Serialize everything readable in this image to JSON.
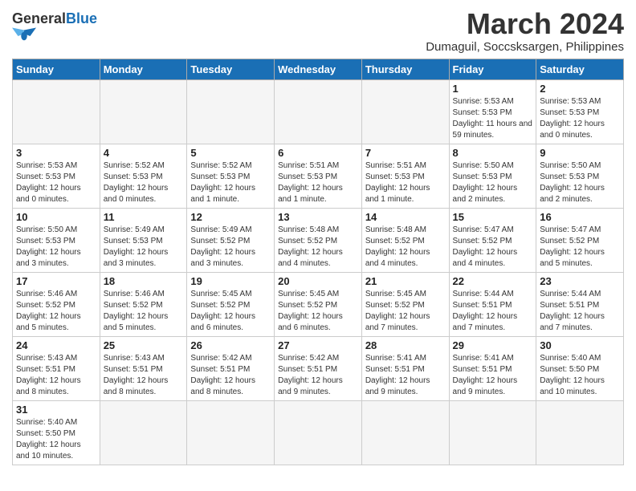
{
  "logo": {
    "general": "General",
    "blue": "Blue"
  },
  "title": {
    "month_year": "March 2024",
    "location": "Dumaguil, Soccsksargen, Philippines"
  },
  "headers": [
    "Sunday",
    "Monday",
    "Tuesday",
    "Wednesday",
    "Thursday",
    "Friday",
    "Saturday"
  ],
  "weeks": [
    [
      {
        "day": "",
        "info": ""
      },
      {
        "day": "",
        "info": ""
      },
      {
        "day": "",
        "info": ""
      },
      {
        "day": "",
        "info": ""
      },
      {
        "day": "",
        "info": ""
      },
      {
        "day": "1",
        "info": "Sunrise: 5:53 AM\nSunset: 5:53 PM\nDaylight: 11 hours and 59 minutes."
      },
      {
        "day": "2",
        "info": "Sunrise: 5:53 AM\nSunset: 5:53 PM\nDaylight: 12 hours and 0 minutes."
      }
    ],
    [
      {
        "day": "3",
        "info": "Sunrise: 5:53 AM\nSunset: 5:53 PM\nDaylight: 12 hours and 0 minutes."
      },
      {
        "day": "4",
        "info": "Sunrise: 5:52 AM\nSunset: 5:53 PM\nDaylight: 12 hours and 0 minutes."
      },
      {
        "day": "5",
        "info": "Sunrise: 5:52 AM\nSunset: 5:53 PM\nDaylight: 12 hours and 1 minute."
      },
      {
        "day": "6",
        "info": "Sunrise: 5:51 AM\nSunset: 5:53 PM\nDaylight: 12 hours and 1 minute."
      },
      {
        "day": "7",
        "info": "Sunrise: 5:51 AM\nSunset: 5:53 PM\nDaylight: 12 hours and 1 minute."
      },
      {
        "day": "8",
        "info": "Sunrise: 5:50 AM\nSunset: 5:53 PM\nDaylight: 12 hours and 2 minutes."
      },
      {
        "day": "9",
        "info": "Sunrise: 5:50 AM\nSunset: 5:53 PM\nDaylight: 12 hours and 2 minutes."
      }
    ],
    [
      {
        "day": "10",
        "info": "Sunrise: 5:50 AM\nSunset: 5:53 PM\nDaylight: 12 hours and 3 minutes."
      },
      {
        "day": "11",
        "info": "Sunrise: 5:49 AM\nSunset: 5:53 PM\nDaylight: 12 hours and 3 minutes."
      },
      {
        "day": "12",
        "info": "Sunrise: 5:49 AM\nSunset: 5:52 PM\nDaylight: 12 hours and 3 minutes."
      },
      {
        "day": "13",
        "info": "Sunrise: 5:48 AM\nSunset: 5:52 PM\nDaylight: 12 hours and 4 minutes."
      },
      {
        "day": "14",
        "info": "Sunrise: 5:48 AM\nSunset: 5:52 PM\nDaylight: 12 hours and 4 minutes."
      },
      {
        "day": "15",
        "info": "Sunrise: 5:47 AM\nSunset: 5:52 PM\nDaylight: 12 hours and 4 minutes."
      },
      {
        "day": "16",
        "info": "Sunrise: 5:47 AM\nSunset: 5:52 PM\nDaylight: 12 hours and 5 minutes."
      }
    ],
    [
      {
        "day": "17",
        "info": "Sunrise: 5:46 AM\nSunset: 5:52 PM\nDaylight: 12 hours and 5 minutes."
      },
      {
        "day": "18",
        "info": "Sunrise: 5:46 AM\nSunset: 5:52 PM\nDaylight: 12 hours and 5 minutes."
      },
      {
        "day": "19",
        "info": "Sunrise: 5:45 AM\nSunset: 5:52 PM\nDaylight: 12 hours and 6 minutes."
      },
      {
        "day": "20",
        "info": "Sunrise: 5:45 AM\nSunset: 5:52 PM\nDaylight: 12 hours and 6 minutes."
      },
      {
        "day": "21",
        "info": "Sunrise: 5:45 AM\nSunset: 5:52 PM\nDaylight: 12 hours and 7 minutes."
      },
      {
        "day": "22",
        "info": "Sunrise: 5:44 AM\nSunset: 5:51 PM\nDaylight: 12 hours and 7 minutes."
      },
      {
        "day": "23",
        "info": "Sunrise: 5:44 AM\nSunset: 5:51 PM\nDaylight: 12 hours and 7 minutes."
      }
    ],
    [
      {
        "day": "24",
        "info": "Sunrise: 5:43 AM\nSunset: 5:51 PM\nDaylight: 12 hours and 8 minutes."
      },
      {
        "day": "25",
        "info": "Sunrise: 5:43 AM\nSunset: 5:51 PM\nDaylight: 12 hours and 8 minutes."
      },
      {
        "day": "26",
        "info": "Sunrise: 5:42 AM\nSunset: 5:51 PM\nDaylight: 12 hours and 8 minutes."
      },
      {
        "day": "27",
        "info": "Sunrise: 5:42 AM\nSunset: 5:51 PM\nDaylight: 12 hours and 9 minutes."
      },
      {
        "day": "28",
        "info": "Sunrise: 5:41 AM\nSunset: 5:51 PM\nDaylight: 12 hours and 9 minutes."
      },
      {
        "day": "29",
        "info": "Sunrise: 5:41 AM\nSunset: 5:51 PM\nDaylight: 12 hours and 9 minutes."
      },
      {
        "day": "30",
        "info": "Sunrise: 5:40 AM\nSunset: 5:50 PM\nDaylight: 12 hours and 10 minutes."
      }
    ],
    [
      {
        "day": "31",
        "info": "Sunrise: 5:40 AM\nSunset: 5:50 PM\nDaylight: 12 hours and 10 minutes."
      },
      {
        "day": "",
        "info": ""
      },
      {
        "day": "",
        "info": ""
      },
      {
        "day": "",
        "info": ""
      },
      {
        "day": "",
        "info": ""
      },
      {
        "day": "",
        "info": ""
      },
      {
        "day": "",
        "info": ""
      }
    ]
  ]
}
